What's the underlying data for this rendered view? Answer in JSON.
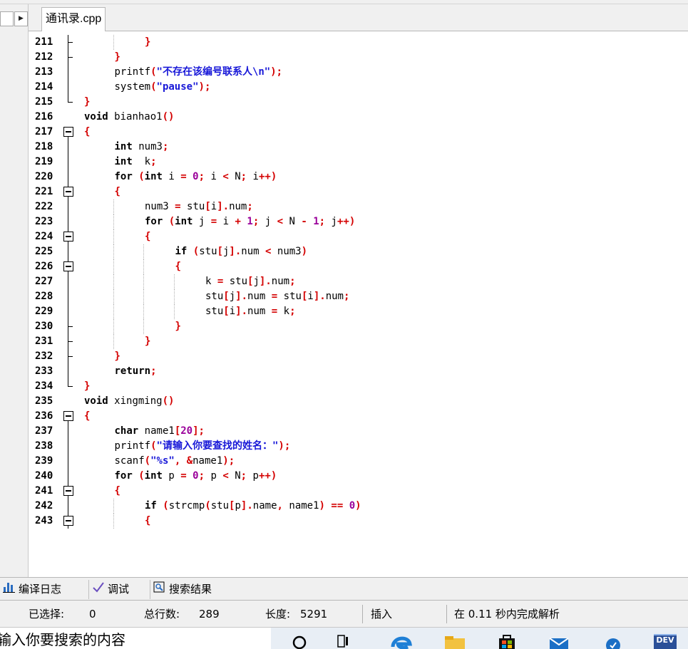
{
  "editor": {
    "tab_label": "通讯录.cpp",
    "lines": [
      {
        "n": "211",
        "fold": "line-tick",
        "indent": 2,
        "guides": [
          1
        ],
        "html": "<span class=\"br\">}</span>"
      },
      {
        "n": "212",
        "fold": "line-tick",
        "indent": 1,
        "guides": [],
        "html": "<span class=\"br\">}</span>"
      },
      {
        "n": "213",
        "fold": "line",
        "indent": 1,
        "guides": [],
        "html": "<span class=\"pl\">printf</span><span class=\"br\">(</span><span class=\"str\">\"不存在该编号联系人\\n\"</span><span class=\"br\">)</span><span class=\"op\">;</span>"
      },
      {
        "n": "214",
        "fold": "line",
        "indent": 1,
        "guides": [],
        "html": "<span class=\"pl\">system</span><span class=\"br\">(</span><span class=\"str\">\"pause\"</span><span class=\"br\">)</span><span class=\"op\">;</span>"
      },
      {
        "n": "215",
        "fold": "end",
        "indent": 0,
        "guides": [],
        "html": "<span class=\"br\">}</span>"
      },
      {
        "n": "216",
        "fold": "none",
        "indent": 0,
        "guides": [],
        "html": "<span class=\"kw\">void</span> <span class=\"pl\">bianhao1</span><span class=\"br\">()</span>"
      },
      {
        "n": "217",
        "fold": "box-first",
        "indent": 0,
        "guides": [],
        "html": "<span class=\"br\">{</span>"
      },
      {
        "n": "218",
        "fold": "line",
        "indent": 1,
        "guides": [],
        "html": "<span class=\"kw\">int</span> <span class=\"pl\">num3</span><span class=\"op\">;</span>"
      },
      {
        "n": "219",
        "fold": "line",
        "indent": 1,
        "guides": [],
        "html": "<span class=\"kw\">int</span>  <span class=\"pl\">k</span><span class=\"op\">;</span>"
      },
      {
        "n": "220",
        "fold": "line",
        "indent": 1,
        "guides": [],
        "html": "<span class=\"kw\">for</span> <span class=\"br\">(</span><span class=\"kw\">int</span> <span class=\"pl\">i</span> <span class=\"op\">=</span> <span class=\"num\">0</span><span class=\"op\">;</span> <span class=\"pl\">i</span> <span class=\"op\">&lt;</span> <span class=\"pl\">N</span><span class=\"op\">;</span> <span class=\"pl\">i</span><span class=\"op\">++</span><span class=\"br\">)</span>"
      },
      {
        "n": "221",
        "fold": "box",
        "indent": 1,
        "guides": [],
        "html": "<span class=\"br\">{</span>"
      },
      {
        "n": "222",
        "fold": "line",
        "indent": 2,
        "guides": [
          1
        ],
        "html": "<span class=\"pl\">num3</span> <span class=\"op\">=</span> <span class=\"pl\">stu</span><span class=\"br\">[</span><span class=\"pl\">i</span><span class=\"br\">]</span><span class=\"op\">.</span><span class=\"pl\">num</span><span class=\"op\">;</span>"
      },
      {
        "n": "223",
        "fold": "line",
        "indent": 2,
        "guides": [
          1
        ],
        "html": "<span class=\"kw\">for</span> <span class=\"br\">(</span><span class=\"kw\">int</span> <span class=\"pl\">j</span> <span class=\"op\">=</span> <span class=\"pl\">i</span> <span class=\"op\">+</span> <span class=\"num\">1</span><span class=\"op\">;</span> <span class=\"pl\">j</span> <span class=\"op\">&lt;</span> <span class=\"pl\">N</span> <span class=\"op\">-</span> <span class=\"num\">1</span><span class=\"op\">;</span> <span class=\"pl\">j</span><span class=\"op\">++</span><span class=\"br\">)</span>"
      },
      {
        "n": "224",
        "fold": "box",
        "indent": 2,
        "guides": [
          1
        ],
        "html": "<span class=\"br\">{</span>"
      },
      {
        "n": "225",
        "fold": "line",
        "indent": 3,
        "guides": [
          1,
          2
        ],
        "html": "<span class=\"kw\">if</span> <span class=\"br\">(</span><span class=\"pl\">stu</span><span class=\"br\">[</span><span class=\"pl\">j</span><span class=\"br\">]</span><span class=\"op\">.</span><span class=\"pl\">num</span> <span class=\"op\">&lt;</span> <span class=\"pl\">num3</span><span class=\"br\">)</span>"
      },
      {
        "n": "226",
        "fold": "box",
        "indent": 3,
        "guides": [
          1,
          2
        ],
        "html": "<span class=\"br\">{</span>"
      },
      {
        "n": "227",
        "fold": "line",
        "indent": 4,
        "guides": [
          1,
          2,
          3
        ],
        "html": "<span class=\"pl\">k</span> <span class=\"op\">=</span> <span class=\"pl\">stu</span><span class=\"br\">[</span><span class=\"pl\">j</span><span class=\"br\">]</span><span class=\"op\">.</span><span class=\"pl\">num</span><span class=\"op\">;</span>"
      },
      {
        "n": "228",
        "fold": "line",
        "indent": 4,
        "guides": [
          1,
          2,
          3
        ],
        "html": "<span class=\"pl\">stu</span><span class=\"br\">[</span><span class=\"pl\">j</span><span class=\"br\">]</span><span class=\"op\">.</span><span class=\"pl\">num</span> <span class=\"op\">=</span> <span class=\"pl\">stu</span><span class=\"br\">[</span><span class=\"pl\">i</span><span class=\"br\">]</span><span class=\"op\">.</span><span class=\"pl\">num</span><span class=\"op\">;</span>"
      },
      {
        "n": "229",
        "fold": "line",
        "indent": 4,
        "guides": [
          1,
          2,
          3
        ],
        "html": "<span class=\"pl\">stu</span><span class=\"br\">[</span><span class=\"pl\">i</span><span class=\"br\">]</span><span class=\"op\">.</span><span class=\"pl\">num</span> <span class=\"op\">=</span> <span class=\"pl\">k</span><span class=\"op\">;</span>"
      },
      {
        "n": "230",
        "fold": "line-tick",
        "indent": 3,
        "guides": [
          1,
          2
        ],
        "html": "<span class=\"br\">}</span>"
      },
      {
        "n": "231",
        "fold": "line-tick",
        "indent": 2,
        "guides": [
          1
        ],
        "html": "<span class=\"br\">}</span>"
      },
      {
        "n": "232",
        "fold": "line-tick",
        "indent": 1,
        "guides": [],
        "html": "<span class=\"br\">}</span>"
      },
      {
        "n": "233",
        "fold": "line",
        "indent": 1,
        "guides": [],
        "html": "<span class=\"kw\">return</span><span class=\"op\">;</span>"
      },
      {
        "n": "234",
        "fold": "end",
        "indent": 0,
        "guides": [],
        "html": "<span class=\"br\">}</span>"
      },
      {
        "n": "235",
        "fold": "none",
        "indent": 0,
        "guides": [],
        "html": "<span class=\"kw\">void</span> <span class=\"pl\">xingming</span><span class=\"br\">()</span>"
      },
      {
        "n": "236",
        "fold": "box-first",
        "indent": 0,
        "guides": [],
        "html": "<span class=\"br\">{</span>"
      },
      {
        "n": "237",
        "fold": "line",
        "indent": 1,
        "guides": [],
        "html": "<span class=\"kw\">char</span> <span class=\"pl\">name1</span><span class=\"br\">[</span><span class=\"num\">20</span><span class=\"br\">]</span><span class=\"op\">;</span>"
      },
      {
        "n": "238",
        "fold": "line",
        "indent": 1,
        "guides": [],
        "html": "<span class=\"pl\">printf</span><span class=\"br\">(</span><span class=\"str\">\"请输入你要查找的姓名：\"</span><span class=\"br\">)</span><span class=\"op\">;</span>"
      },
      {
        "n": "239",
        "fold": "line",
        "indent": 1,
        "guides": [],
        "html": "<span class=\"pl\">scanf</span><span class=\"br\">(</span><span class=\"str\">\"%s\"</span><span class=\"op\">,</span> <span class=\"op\">&amp;</span><span class=\"pl\">name1</span><span class=\"br\">)</span><span class=\"op\">;</span>"
      },
      {
        "n": "240",
        "fold": "line",
        "indent": 1,
        "guides": [],
        "html": "<span class=\"kw\">for</span> <span class=\"br\">(</span><span class=\"kw\">int</span> <span class=\"pl\">p</span> <span class=\"op\">=</span> <span class=\"num\">0</span><span class=\"op\">;</span> <span class=\"pl\">p</span> <span class=\"op\">&lt;</span> <span class=\"pl\">N</span><span class=\"op\">;</span> <span class=\"pl\">p</span><span class=\"op\">++</span><span class=\"br\">)</span>"
      },
      {
        "n": "241",
        "fold": "box",
        "indent": 1,
        "guides": [],
        "html": "<span class=\"br\">{</span>"
      },
      {
        "n": "242",
        "fold": "line",
        "indent": 2,
        "guides": [
          1
        ],
        "html": "<span class=\"kw\">if</span> <span class=\"br\">(</span><span class=\"pl\">strcmp</span><span class=\"br\">(</span><span class=\"pl\">stu</span><span class=\"br\">[</span><span class=\"pl\">p</span><span class=\"br\">]</span><span class=\"op\">.</span><span class=\"pl\">name</span><span class=\"op\">,</span> <span class=\"pl\">name1</span><span class=\"br\">)</span> <span class=\"op\">==</span> <span class=\"num\">0</span><span class=\"br\">)</span>"
      },
      {
        "n": "243",
        "fold": "box",
        "indent": 2,
        "guides": [
          1
        ],
        "html": "<span class=\"br\">{</span>"
      }
    ]
  },
  "bottom_tabs": {
    "compile_log": "编译日志",
    "debug": "调试",
    "search_results": "搜索结果"
  },
  "status": {
    "selected_label": "已选择:",
    "selected_value": "0",
    "total_lines_label": "总行数:",
    "total_lines_value": "289",
    "length_label": "长度:",
    "length_value": "5291",
    "mode": "插入",
    "parse_message": "在 0.11 秒内完成解析"
  },
  "taskbar": {
    "search_text": "输入你要搜索的内容",
    "dev_label": "DEV"
  },
  "colors": {
    "bracket": "#d40000",
    "string": "#1818d8",
    "number": "#9a009a",
    "keyword": "#000000"
  }
}
